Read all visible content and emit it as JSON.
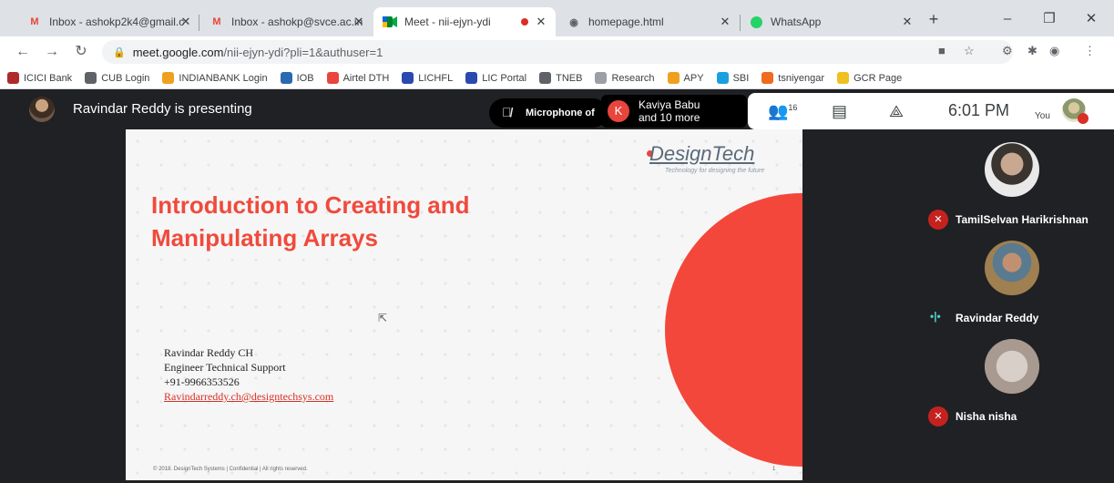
{
  "browser": {
    "tabs": [
      {
        "title": "Inbox - ashokp2k4@gmail.c",
        "icon": "gmail-icon",
        "color": "#ea4335"
      },
      {
        "title": "Inbox - ashokp@svce.ac.in",
        "icon": "gmail-icon",
        "color": "#ea4335"
      },
      {
        "title": "Meet - nii-ejyn-ydi",
        "icon": "meet-icon",
        "color": "#00832d"
      },
      {
        "title": "homepage.html",
        "icon": "globe-icon",
        "color": "#5f6368"
      },
      {
        "title": "WhatsApp",
        "icon": "whatsapp-icon",
        "color": "#25d366"
      }
    ],
    "url_host": "meet.google.com",
    "url_path": "/nii-ejyn-ydi?pli=1&authuser=1"
  },
  "bookmarks": [
    {
      "label": "ICICI Bank",
      "color": "#b02a2a"
    },
    {
      "label": "CUB Login",
      "color": "#5f6368"
    },
    {
      "label": "INDIANBANK Login",
      "color": "#f0a020"
    },
    {
      "label": "IOB",
      "color": "#2a6ab0"
    },
    {
      "label": "Airtel DTH",
      "color": "#e8453c"
    },
    {
      "label": "LICHFL",
      "color": "#2a4ab0"
    },
    {
      "label": "LIC Portal",
      "color": "#2a4ab0"
    },
    {
      "label": "TNEB",
      "color": "#5f6368"
    },
    {
      "label": "Research",
      "color": "#9aa0a6"
    },
    {
      "label": "APY",
      "color": "#f0a020"
    },
    {
      "label": "SBI",
      "color": "#1aa0e0"
    },
    {
      "label": "tsniyengar",
      "color": "#f06a20"
    },
    {
      "label": "GCR Page",
      "color": "#f0c020"
    }
  ],
  "meet": {
    "presenting_text": "Ravindar Reddy is presenting",
    "mic_text": "Microphone of",
    "join_initial": "K",
    "join_line1": "Kaviya Babu",
    "join_line2": "and 10 more",
    "people_count": "16",
    "clock": "6:01 PM",
    "you_label": "You"
  },
  "slide": {
    "logo": "DesignTech",
    "tagline": "Technology for designing the future",
    "title_line1": "Introduction to Creating and",
    "title_line2": "Manipulating Arrays",
    "presenter_name": "Ravindar Reddy CH",
    "presenter_role": "Engineer Technical Support",
    "presenter_phone": "+91-9966353526",
    "presenter_email": "Ravindarreddy.ch@designtechsys.com",
    "footer": "© 2018. DesignTech Systems | Confidential | All rights reserved.",
    "page_number": "1"
  },
  "participants": [
    {
      "name": "TamilSelvan Harikrishnan",
      "state": "muted"
    },
    {
      "name": "Ravindar Reddy",
      "state": "speaking"
    },
    {
      "name": "Nisha nisha",
      "state": "muted"
    }
  ]
}
